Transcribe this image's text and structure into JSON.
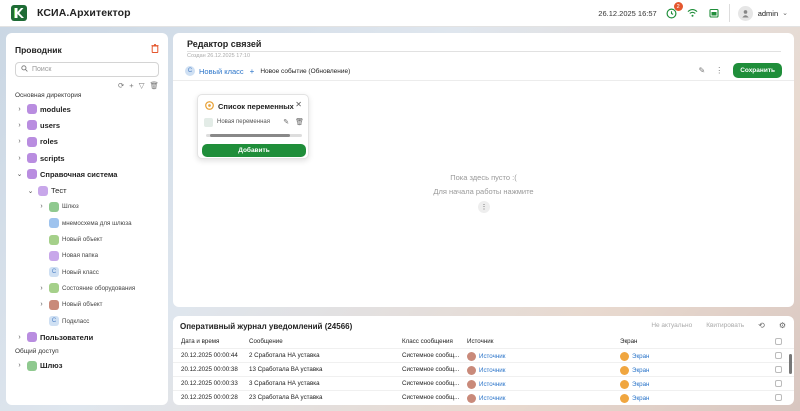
{
  "app": {
    "title": "КСИА.Архитектор",
    "datetime": "26.12.2025 16:57",
    "notifications_count": "2",
    "user": "admin",
    "brand_color": "#1f8e3a"
  },
  "sidebar": {
    "title": "Проводник",
    "search_placeholder": "Поиск",
    "section_main": "Основная директория",
    "section_shared": "Общий доступ",
    "tree": [
      {
        "label": "modules",
        "level": 0,
        "chev": "›",
        "color": "#b98de0",
        "glyph": ""
      },
      {
        "label": "users",
        "level": 0,
        "chev": "›",
        "color": "#b98de0",
        "glyph": ""
      },
      {
        "label": "roles",
        "level": 0,
        "chev": "›",
        "color": "#b98de0",
        "glyph": ""
      },
      {
        "label": "scripts",
        "level": 0,
        "chev": "›",
        "color": "#b98de0",
        "glyph": ""
      },
      {
        "label": "Справочная система",
        "level": 0,
        "chev": "⌄",
        "color": "#b98de0",
        "glyph": ""
      },
      {
        "label": "Тест",
        "level": 1,
        "chev": "⌄",
        "color": "#c8a7ea",
        "glyph": ""
      },
      {
        "label": "Шлюз",
        "level": 2,
        "chev": "›",
        "color": "#8fc98f",
        "glyph": ""
      },
      {
        "label": "мнемосхема для шлюза",
        "level": 2,
        "chev": "",
        "color": "#9ec3ee",
        "glyph": ""
      },
      {
        "label": "Новый объект",
        "level": 2,
        "chev": "",
        "color": "#a5d08a",
        "glyph": ""
      },
      {
        "label": "Новая папка",
        "level": 2,
        "chev": "",
        "color": "#c8a7ea",
        "glyph": ""
      },
      {
        "label": "Новый класс",
        "level": 2,
        "chev": "",
        "color": "#cfe0f3",
        "glyph": "C"
      },
      {
        "label": "Состояние оборудования",
        "level": 2,
        "chev": "›",
        "color": "#a5d08a",
        "glyph": ""
      },
      {
        "label": "Новый объект",
        "level": 2,
        "chev": "›",
        "color": "#c98a7a",
        "glyph": ""
      },
      {
        "label": "Подкласс",
        "level": 2,
        "chev": "",
        "color": "#cfe0f3",
        "glyph": "C"
      },
      {
        "label": "Пользователи",
        "level": 0,
        "chev": "›",
        "color": "#b98de0",
        "glyph": ""
      }
    ],
    "shared": [
      {
        "label": "Шлюз",
        "level": 0,
        "chev": "›",
        "color": "#8fc98f",
        "glyph": ""
      }
    ]
  },
  "editor": {
    "title": "Редактор связей",
    "created": "Создан 26.12.2025 17:10",
    "crumb_class": "Новый класс",
    "crumb_event": "Новое событие (Обновление)",
    "save_label": "Сохранить",
    "empty_line1": "Пока здесь пусто :(",
    "empty_line2": "Для начала работы нажмите"
  },
  "variables": {
    "title": "Список переменных",
    "item": "Новая переменная",
    "add_label": "Добавить"
  },
  "journal": {
    "title": "Оперативный журнал уведомлений (24566)",
    "action_irrelevant": "Не актуально",
    "action_quit": "Квитировать",
    "columns": [
      "Дата и время",
      "Сообщение",
      "Класс сообщения",
      "Источник",
      "Экран"
    ],
    "rows": [
      {
        "date": "20.12.2025 00:00:44",
        "msg": "2 Сработала НА уставка",
        "cls": "Системное сообщ...",
        "src": "Источник",
        "scr": "Экран"
      },
      {
        "date": "20.12.2025 00:00:38",
        "msg": "13 Сработала ВА уставка",
        "cls": "Системное сообщ...",
        "src": "Источник",
        "scr": "Экран"
      },
      {
        "date": "20.12.2025 00:00:33",
        "msg": "3 Сработала НА уставка",
        "cls": "Системное сообщ...",
        "src": "Источник",
        "scr": "Экран"
      },
      {
        "date": "20.12.2025 00:00:28",
        "msg": "23 Сработала ВА уставка",
        "cls": "Системное сообщ...",
        "src": "Источник",
        "scr": "Экран"
      }
    ]
  }
}
